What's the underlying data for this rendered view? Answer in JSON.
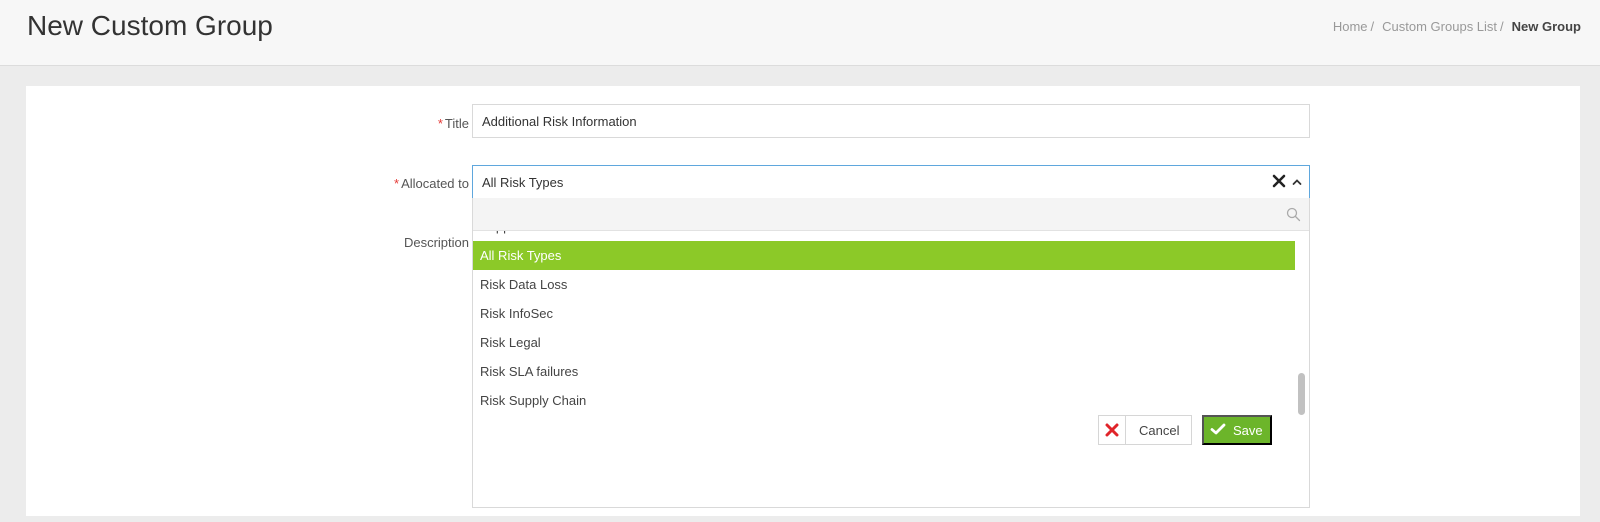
{
  "header": {
    "title": "New Custom Group",
    "breadcrumb": [
      {
        "label": "Home",
        "sep": "/"
      },
      {
        "label": "Custom Groups List",
        "sep": "/"
      },
      {
        "label": "New Group"
      }
    ]
  },
  "form": {
    "required_mark": "*",
    "title_label": "Title",
    "title_value": "Additional Risk Information",
    "allocated_label": "Allocated to",
    "allocated_value": "All Risk Types",
    "description_label": "Description",
    "dropdown": {
      "partial_item": "Supplier User",
      "items": [
        {
          "label": "All Risk Types",
          "selected": true
        },
        {
          "label": "Risk Data Loss",
          "selected": false
        },
        {
          "label": "Risk InfoSec",
          "selected": false
        },
        {
          "label": "Risk Legal",
          "selected": false
        },
        {
          "label": "Risk SLA failures",
          "selected": false
        },
        {
          "label": "Risk Supply Chain",
          "selected": false
        }
      ]
    },
    "cancel_label": "Cancel",
    "save_label": "Save"
  },
  "colors": {
    "accent_green": "#8cc928",
    "save_green": "#6cb52a",
    "focus_blue": "#5fa7dd",
    "cancel_red": "#e0242a"
  },
  "icons": {
    "clear": "close-icon",
    "toggle": "chevron-up-icon",
    "search": "search-icon",
    "cancel": "x-icon",
    "save": "check-icon"
  }
}
